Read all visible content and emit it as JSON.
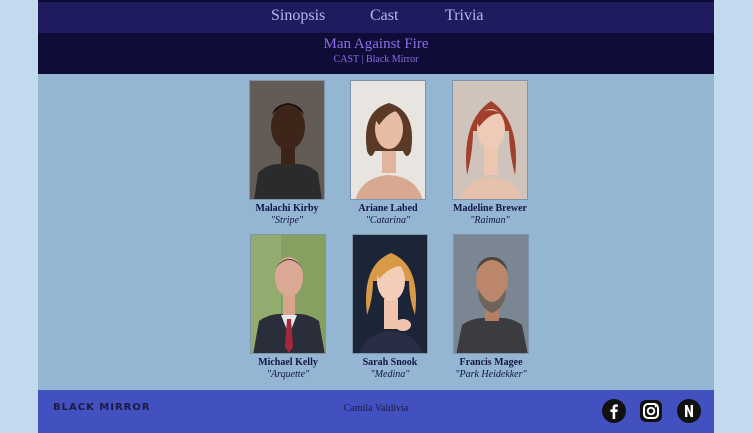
{
  "nav": {
    "items": [
      "Sinopsis",
      "Cast",
      "Trivia"
    ]
  },
  "header": {
    "title": "Man Against Fire",
    "subtitle": "CAST | Black Mirror"
  },
  "cast": [
    {
      "name": "Malachi Kirby",
      "role": "\"Stripe\""
    },
    {
      "name": "Ariane Labed",
      "role": "\"Catarina\""
    },
    {
      "name": "Madeline Brewer",
      "role": "\"Raiman\""
    },
    {
      "name": "Michael Kelly",
      "role": "\"Arquette\""
    },
    {
      "name": "Sarah Snook",
      "role": "\"Medina\""
    },
    {
      "name": "Francis Magee",
      "role": "\"Park Heidekker\""
    }
  ],
  "footer": {
    "logo": "BLACK MIRROR",
    "author": "Camila Valdivia",
    "social_icons": [
      "facebook-icon",
      "instagram-icon",
      "netflix-icon"
    ]
  },
  "colors": {
    "nav_bg": "#1e1c5e",
    "header_bg": "#0f0d38",
    "title": "#8c6ee6",
    "content_bg": "#94b6d2",
    "footer_bg": "#4350bf",
    "side_bg": "#c3d9ee"
  }
}
